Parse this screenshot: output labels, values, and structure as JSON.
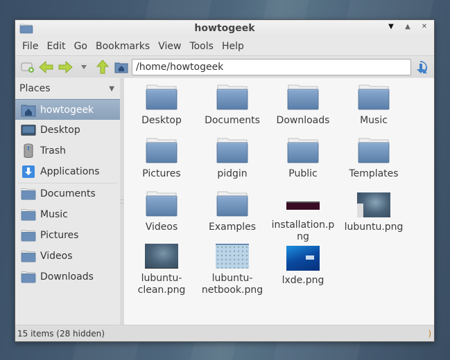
{
  "window": {
    "title": "howtogeek",
    "controls": {
      "minimize": "▼",
      "maximize": "▲",
      "close": "✕"
    }
  },
  "menubar": [
    "File",
    "Edit",
    "Go",
    "Bookmarks",
    "View",
    "Tools",
    "Help"
  ],
  "toolbar": {
    "new_tab_icon": "new-tab-icon",
    "back_icon": "back-arrow-icon",
    "forward_icon": "forward-arrow-icon",
    "history_icon": "history-dropdown-icon",
    "up_icon": "up-arrow-icon",
    "home_icon": "home-icon",
    "path_value": "/home/howtogeek",
    "go_icon": "go-arrow-icon"
  },
  "sidebar": {
    "header": "Places",
    "header_icon": "chevron-down-icon",
    "places": [
      {
        "label": "howtogeek",
        "icon": "home-folder-icon",
        "selected": true
      },
      {
        "label": "Desktop",
        "icon": "desktop-icon"
      },
      {
        "label": "Trash",
        "icon": "trash-icon"
      },
      {
        "label": "Applications",
        "icon": "applications-icon"
      }
    ],
    "bookmarks": [
      {
        "label": "Documents",
        "icon": "folder-icon"
      },
      {
        "label": "Music",
        "icon": "folder-icon"
      },
      {
        "label": "Pictures",
        "icon": "folder-icon"
      },
      {
        "label": "Videos",
        "icon": "folder-icon"
      },
      {
        "label": "Downloads",
        "icon": "folder-icon"
      }
    ]
  },
  "files": [
    {
      "name": "Desktop",
      "type": "folder"
    },
    {
      "name": "Documents",
      "type": "folder"
    },
    {
      "name": "Downloads",
      "type": "folder"
    },
    {
      "name": "Music",
      "type": "folder"
    },
    {
      "name": "Pictures",
      "type": "folder"
    },
    {
      "name": "pidgin",
      "type": "folder"
    },
    {
      "name": "Public",
      "type": "folder"
    },
    {
      "name": "Templates",
      "type": "folder"
    },
    {
      "name": "Videos",
      "type": "folder"
    },
    {
      "name": "Examples",
      "type": "folder"
    },
    {
      "name": "installation.png",
      "type": "image",
      "thumb": "terminal"
    },
    {
      "name": "lubuntu.png",
      "type": "image",
      "thumb": "lubuntu"
    },
    {
      "name": "lubuntu-clean.png",
      "type": "image",
      "thumb": "lubuntu-clean"
    },
    {
      "name": "lubuntu-netbook.png",
      "type": "image",
      "thumb": "netbook"
    },
    {
      "name": "lxde.png",
      "type": "image",
      "thumb": "lxde"
    }
  ],
  "statusbar": {
    "text": "15 items (28 hidden)",
    "right": ")"
  },
  "colors": {
    "selection": "#8aa1b9",
    "folder_blue": "#6b8fb8",
    "arrow_green": "#a8c83a"
  }
}
